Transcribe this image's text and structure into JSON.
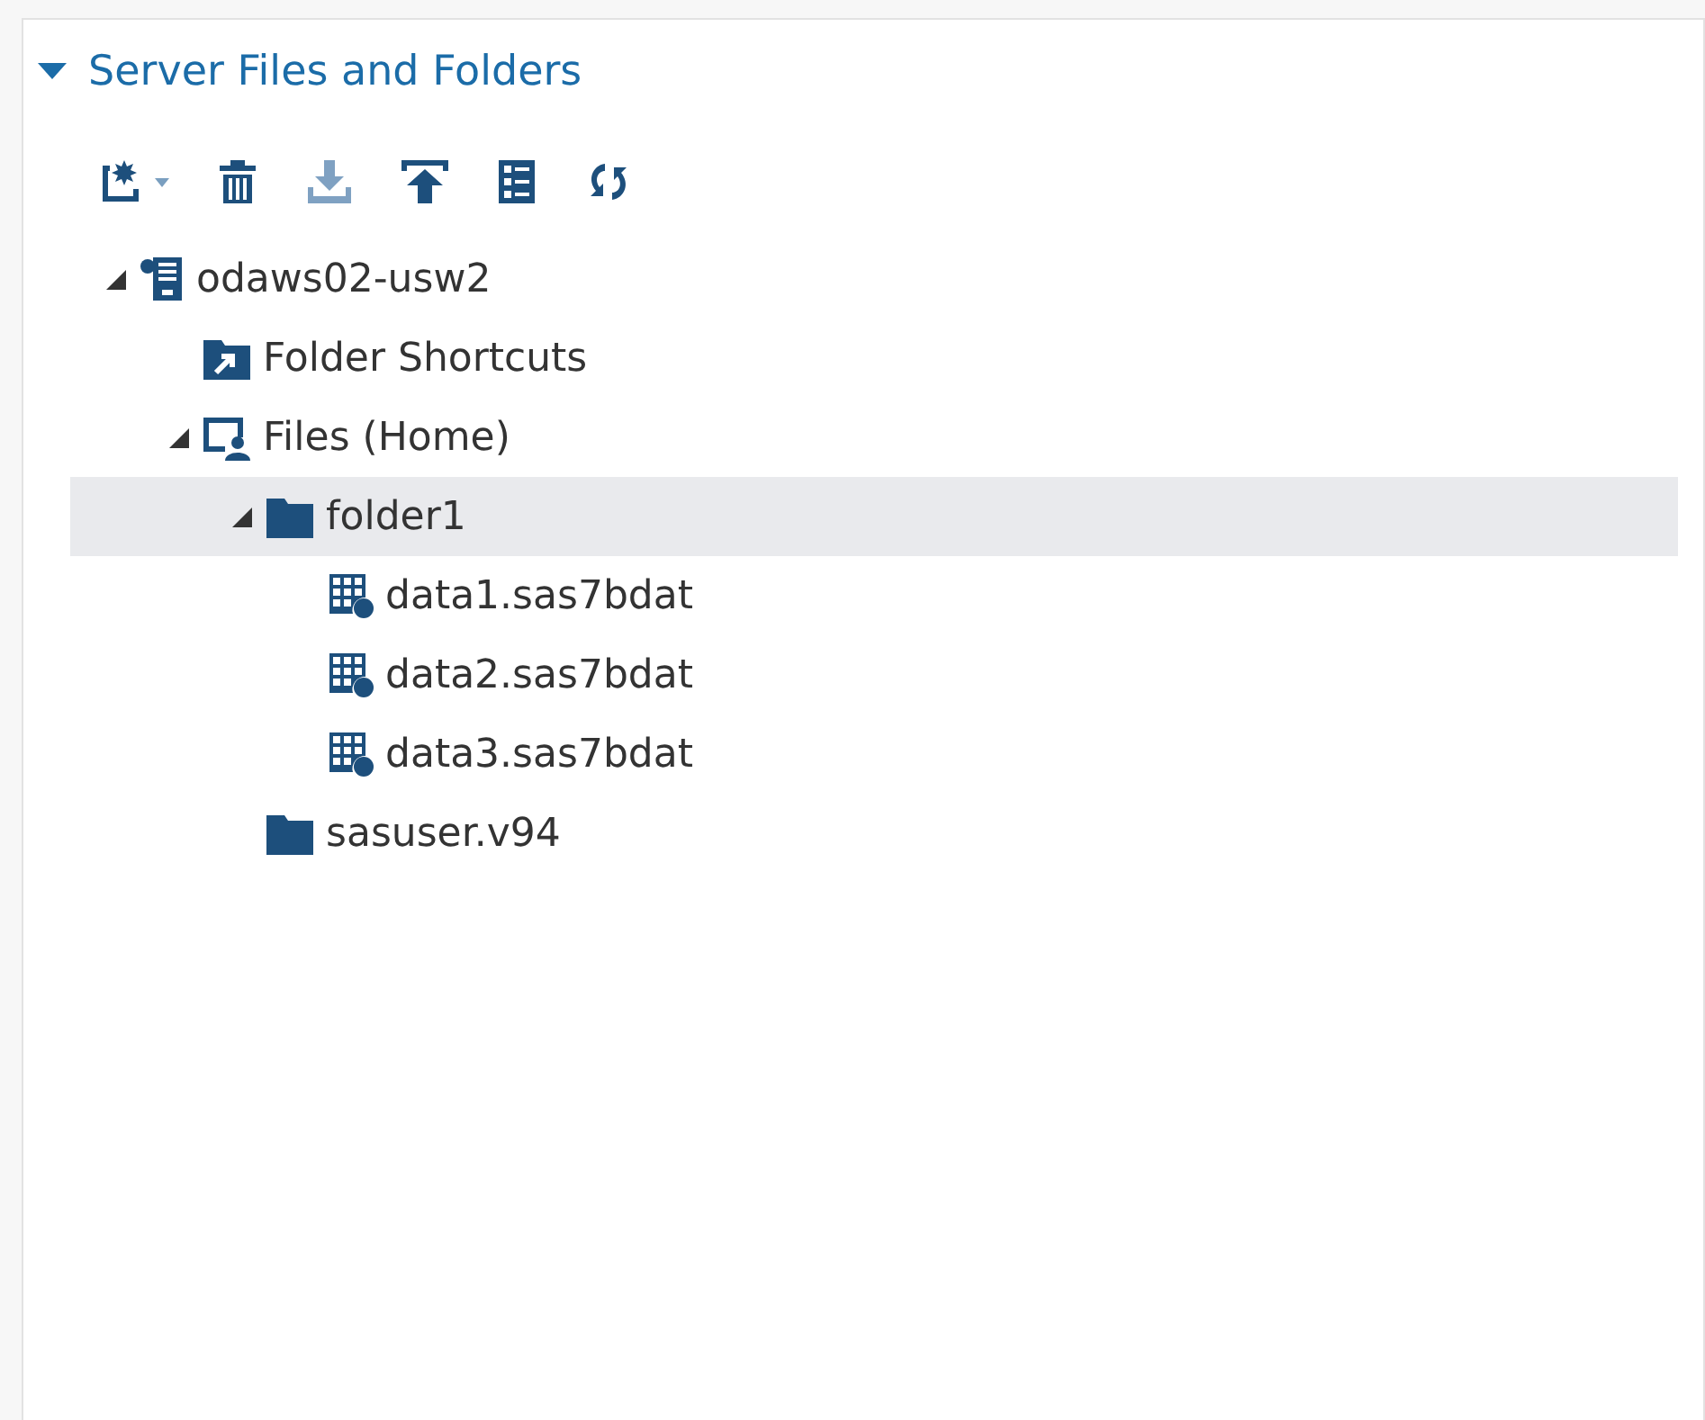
{
  "panel": {
    "title": "Server Files and Folders",
    "expanded": true
  },
  "toolbar": [
    {
      "kind": "new",
      "disabled": false,
      "dropdown": true
    },
    {
      "kind": "delete",
      "disabled": false
    },
    {
      "kind": "download",
      "disabled": true
    },
    {
      "kind": "upload",
      "disabled": false
    },
    {
      "kind": "properties",
      "disabled": false
    },
    {
      "kind": "refresh",
      "disabled": false
    }
  ],
  "tree": [
    {
      "label": "odaws02-usw2",
      "kind": "server",
      "expanded": true,
      "selected": false,
      "children": [
        {
          "label": "Folder Shortcuts",
          "kind": "shortcuts",
          "selected": false
        },
        {
          "label": "Files (Home)",
          "kind": "home",
          "expanded": true,
          "selected": false,
          "children": [
            {
              "label": "folder1",
              "kind": "folder",
              "expanded": true,
              "selected": true,
              "children": [
                {
                  "label": "data1.sas7bdat",
                  "kind": "dataset",
                  "selected": false
                },
                {
                  "label": "data2.sas7bdat",
                  "kind": "dataset",
                  "selected": false
                },
                {
                  "label": "data3.sas7bdat",
                  "kind": "dataset",
                  "selected": false
                }
              ]
            },
            {
              "label": "sasuser.v94",
              "kind": "folder",
              "selected": false
            }
          ]
        }
      ]
    }
  ]
}
